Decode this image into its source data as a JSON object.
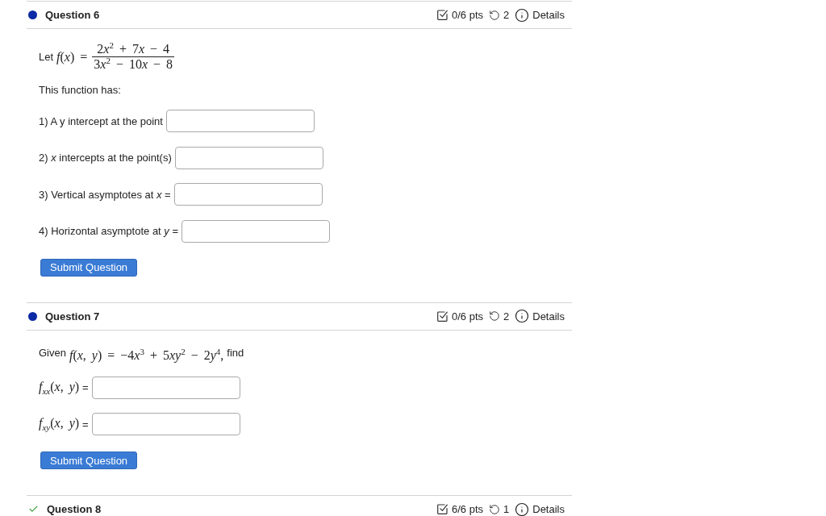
{
  "questions": [
    {
      "title": "Question 6",
      "correct": false,
      "score": "0/6 pts",
      "attempts": "2",
      "details": "Details",
      "prompt": [
        {
          "kind": "text",
          "text": "Let"
        },
        {
          "kind": "math",
          "text": "f(x) ="
        },
        {
          "kind": "fraction",
          "numerator": "2x$^{2}$ + 7x − 4",
          "denominator": "3x$^{2}$ − 10x − 8"
        }
      ],
      "intro": "This function has:",
      "answers": [
        {
          "label": [
            {
              "kind": "text",
              "text": "1) A y intercept at the point"
            }
          ]
        },
        {
          "label": [
            {
              "kind": "text",
              "text": "2) *x* intercepts at the point(s)"
            }
          ]
        },
        {
          "label": [
            {
              "kind": "text",
              "text": "3) Vertical asymptotes at *x* ="
            }
          ]
        },
        {
          "label": [
            {
              "kind": "text",
              "text": "4) Horizontal asymptote at *y* ="
            }
          ]
        }
      ],
      "submit": "Submit Question"
    },
    {
      "title": "Question 7",
      "correct": false,
      "score": "0/6 pts",
      "attempts": "2",
      "details": "Details",
      "prompt": [
        {
          "kind": "text",
          "text": "Given"
        },
        {
          "kind": "math",
          "text": "f(x, y) = −4x$^{3}$ + 5xy$^{2}$ − 2y$^{4}$,"
        },
        {
          "kind": "text",
          "text": "find"
        }
      ],
      "answers": [
        {
          "label": [
            {
              "kind": "math",
              "text": "f$_{xx}$(x, y)"
            },
            {
              "kind": "text",
              "text": "="
            }
          ]
        },
        {
          "label": [
            {
              "kind": "math",
              "text": "f$_{xy}$(x, y)"
            },
            {
              "kind": "text",
              "text": "="
            }
          ]
        }
      ],
      "submit": "Submit Question"
    },
    {
      "title": "Question 8",
      "correct": true,
      "score": "6/6 pts",
      "attempts": "1",
      "details": "Details"
    }
  ]
}
